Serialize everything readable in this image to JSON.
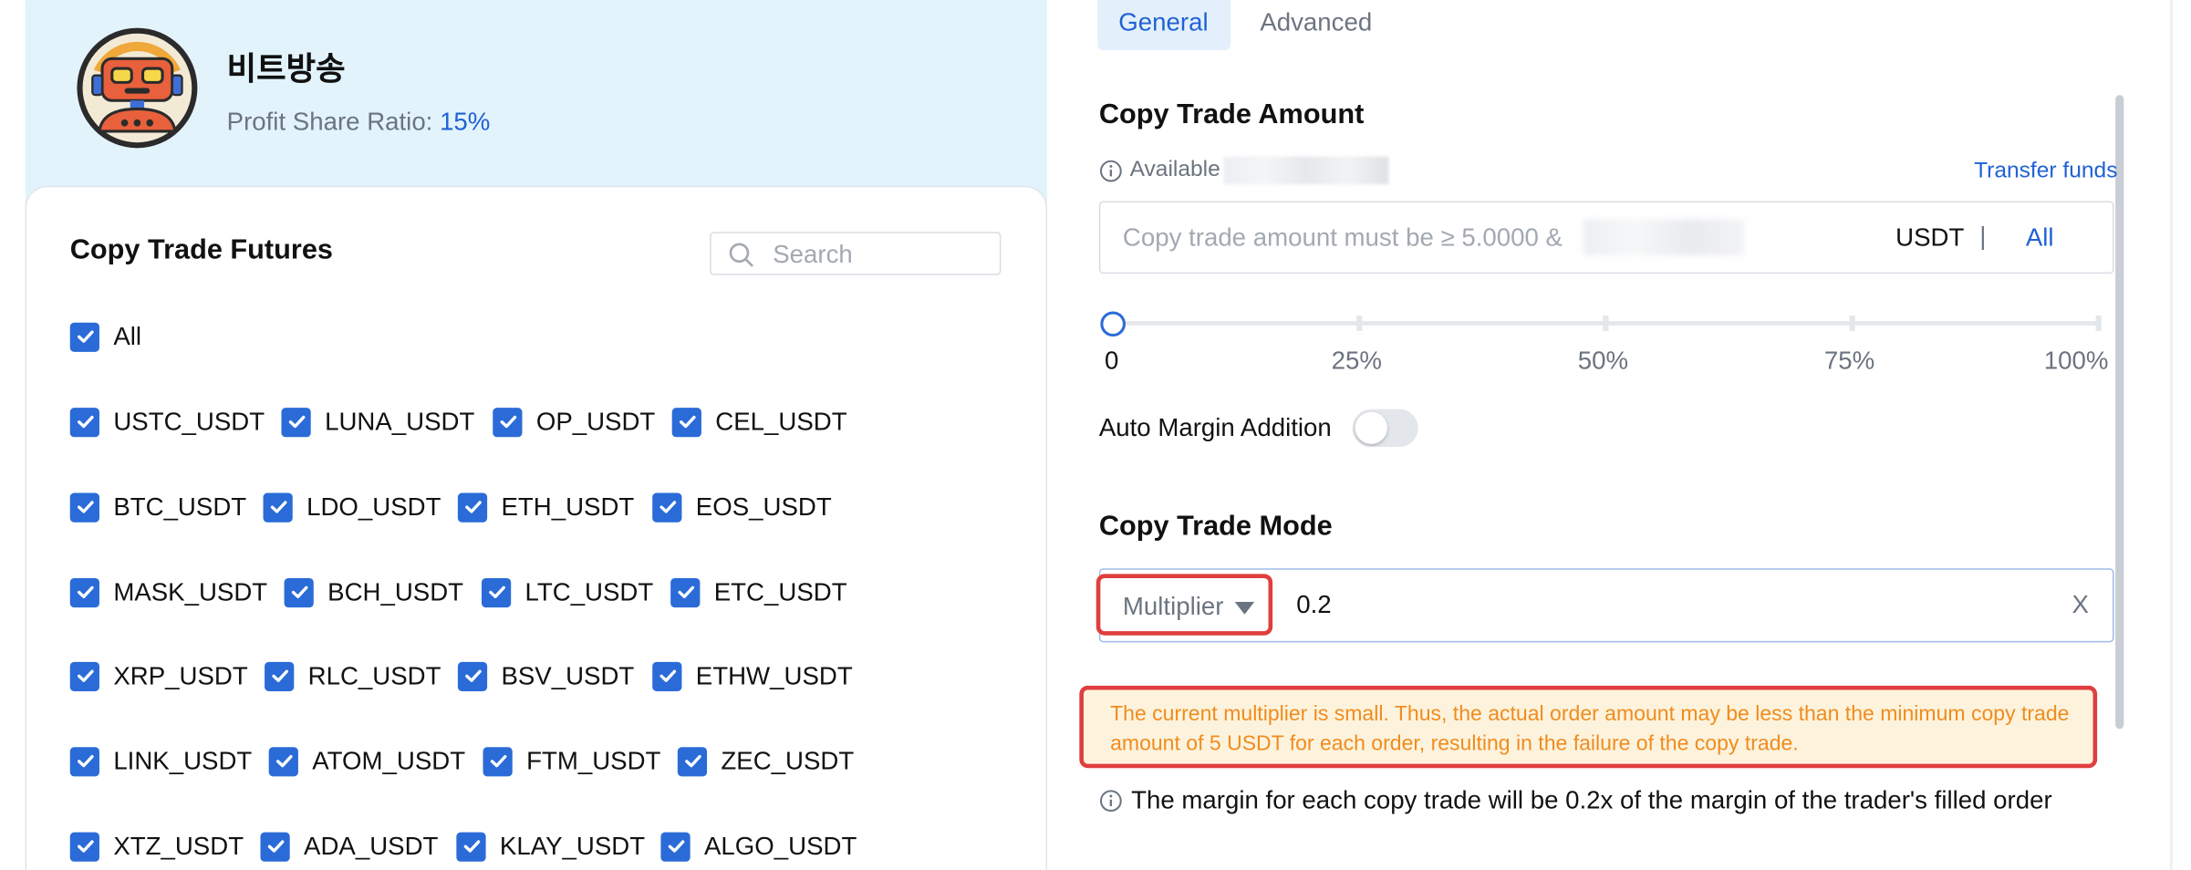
{
  "trader": {
    "name": "비트방송",
    "profit_label": "Profit Share Ratio:",
    "profit_value": "15%"
  },
  "futures": {
    "title": "Copy Trade Futures",
    "search_placeholder": "Search",
    "all_label": "All",
    "items": [
      "USTC_USDT",
      "LUNA_USDT",
      "OP_USDT",
      "CEL_USDT",
      "BTC_USDT",
      "LDO_USDT",
      "ETH_USDT",
      "EOS_USDT",
      "MASK_USDT",
      "BCH_USDT",
      "LTC_USDT",
      "ETC_USDT",
      "XRP_USDT",
      "RLC_USDT",
      "BSV_USDT",
      "ETHW_USDT",
      "LINK_USDT",
      "ATOM_USDT",
      "FTM_USDT",
      "ZEC_USDT",
      "XTZ_USDT",
      "ADA_USDT",
      "KLAY_USDT",
      "ALGO_USDT"
    ]
  },
  "tabs": {
    "general": "General",
    "advanced": "Advanced"
  },
  "amount": {
    "title": "Copy Trade Amount",
    "available_label": "Available",
    "transfer_link": "Transfer funds",
    "placeholder": "Copy trade amount must be ≥ 5.0000 &",
    "unit": "USDT",
    "separator": "|",
    "all_link": "All",
    "slider_labels": [
      "0",
      "25%",
      "50%",
      "75%",
      "100%"
    ],
    "slider_value_percent": 0
  },
  "auto_margin": {
    "label": "Auto Margin Addition",
    "enabled": false
  },
  "mode": {
    "title": "Copy Trade Mode",
    "select_value": "Multiplier",
    "input_value": "0.2",
    "clear_label": "X"
  },
  "warning": {
    "text": "The current multiplier is small. Thus, the actual order amount may be less than the minimum copy trade amount of 5 USDT for each order, resulting in the failure of the copy trade."
  },
  "note": {
    "text": "The margin for each copy trade will be 0.2x of the margin of the trader's filled order"
  },
  "colors": {
    "accent": "#2a6bd8",
    "link": "#2062d4",
    "highlight_border": "#e03e3e",
    "warning_text": "#f08c1e",
    "warning_bg": "#fdf3dd",
    "panel_bg": "#e3f3fc"
  }
}
